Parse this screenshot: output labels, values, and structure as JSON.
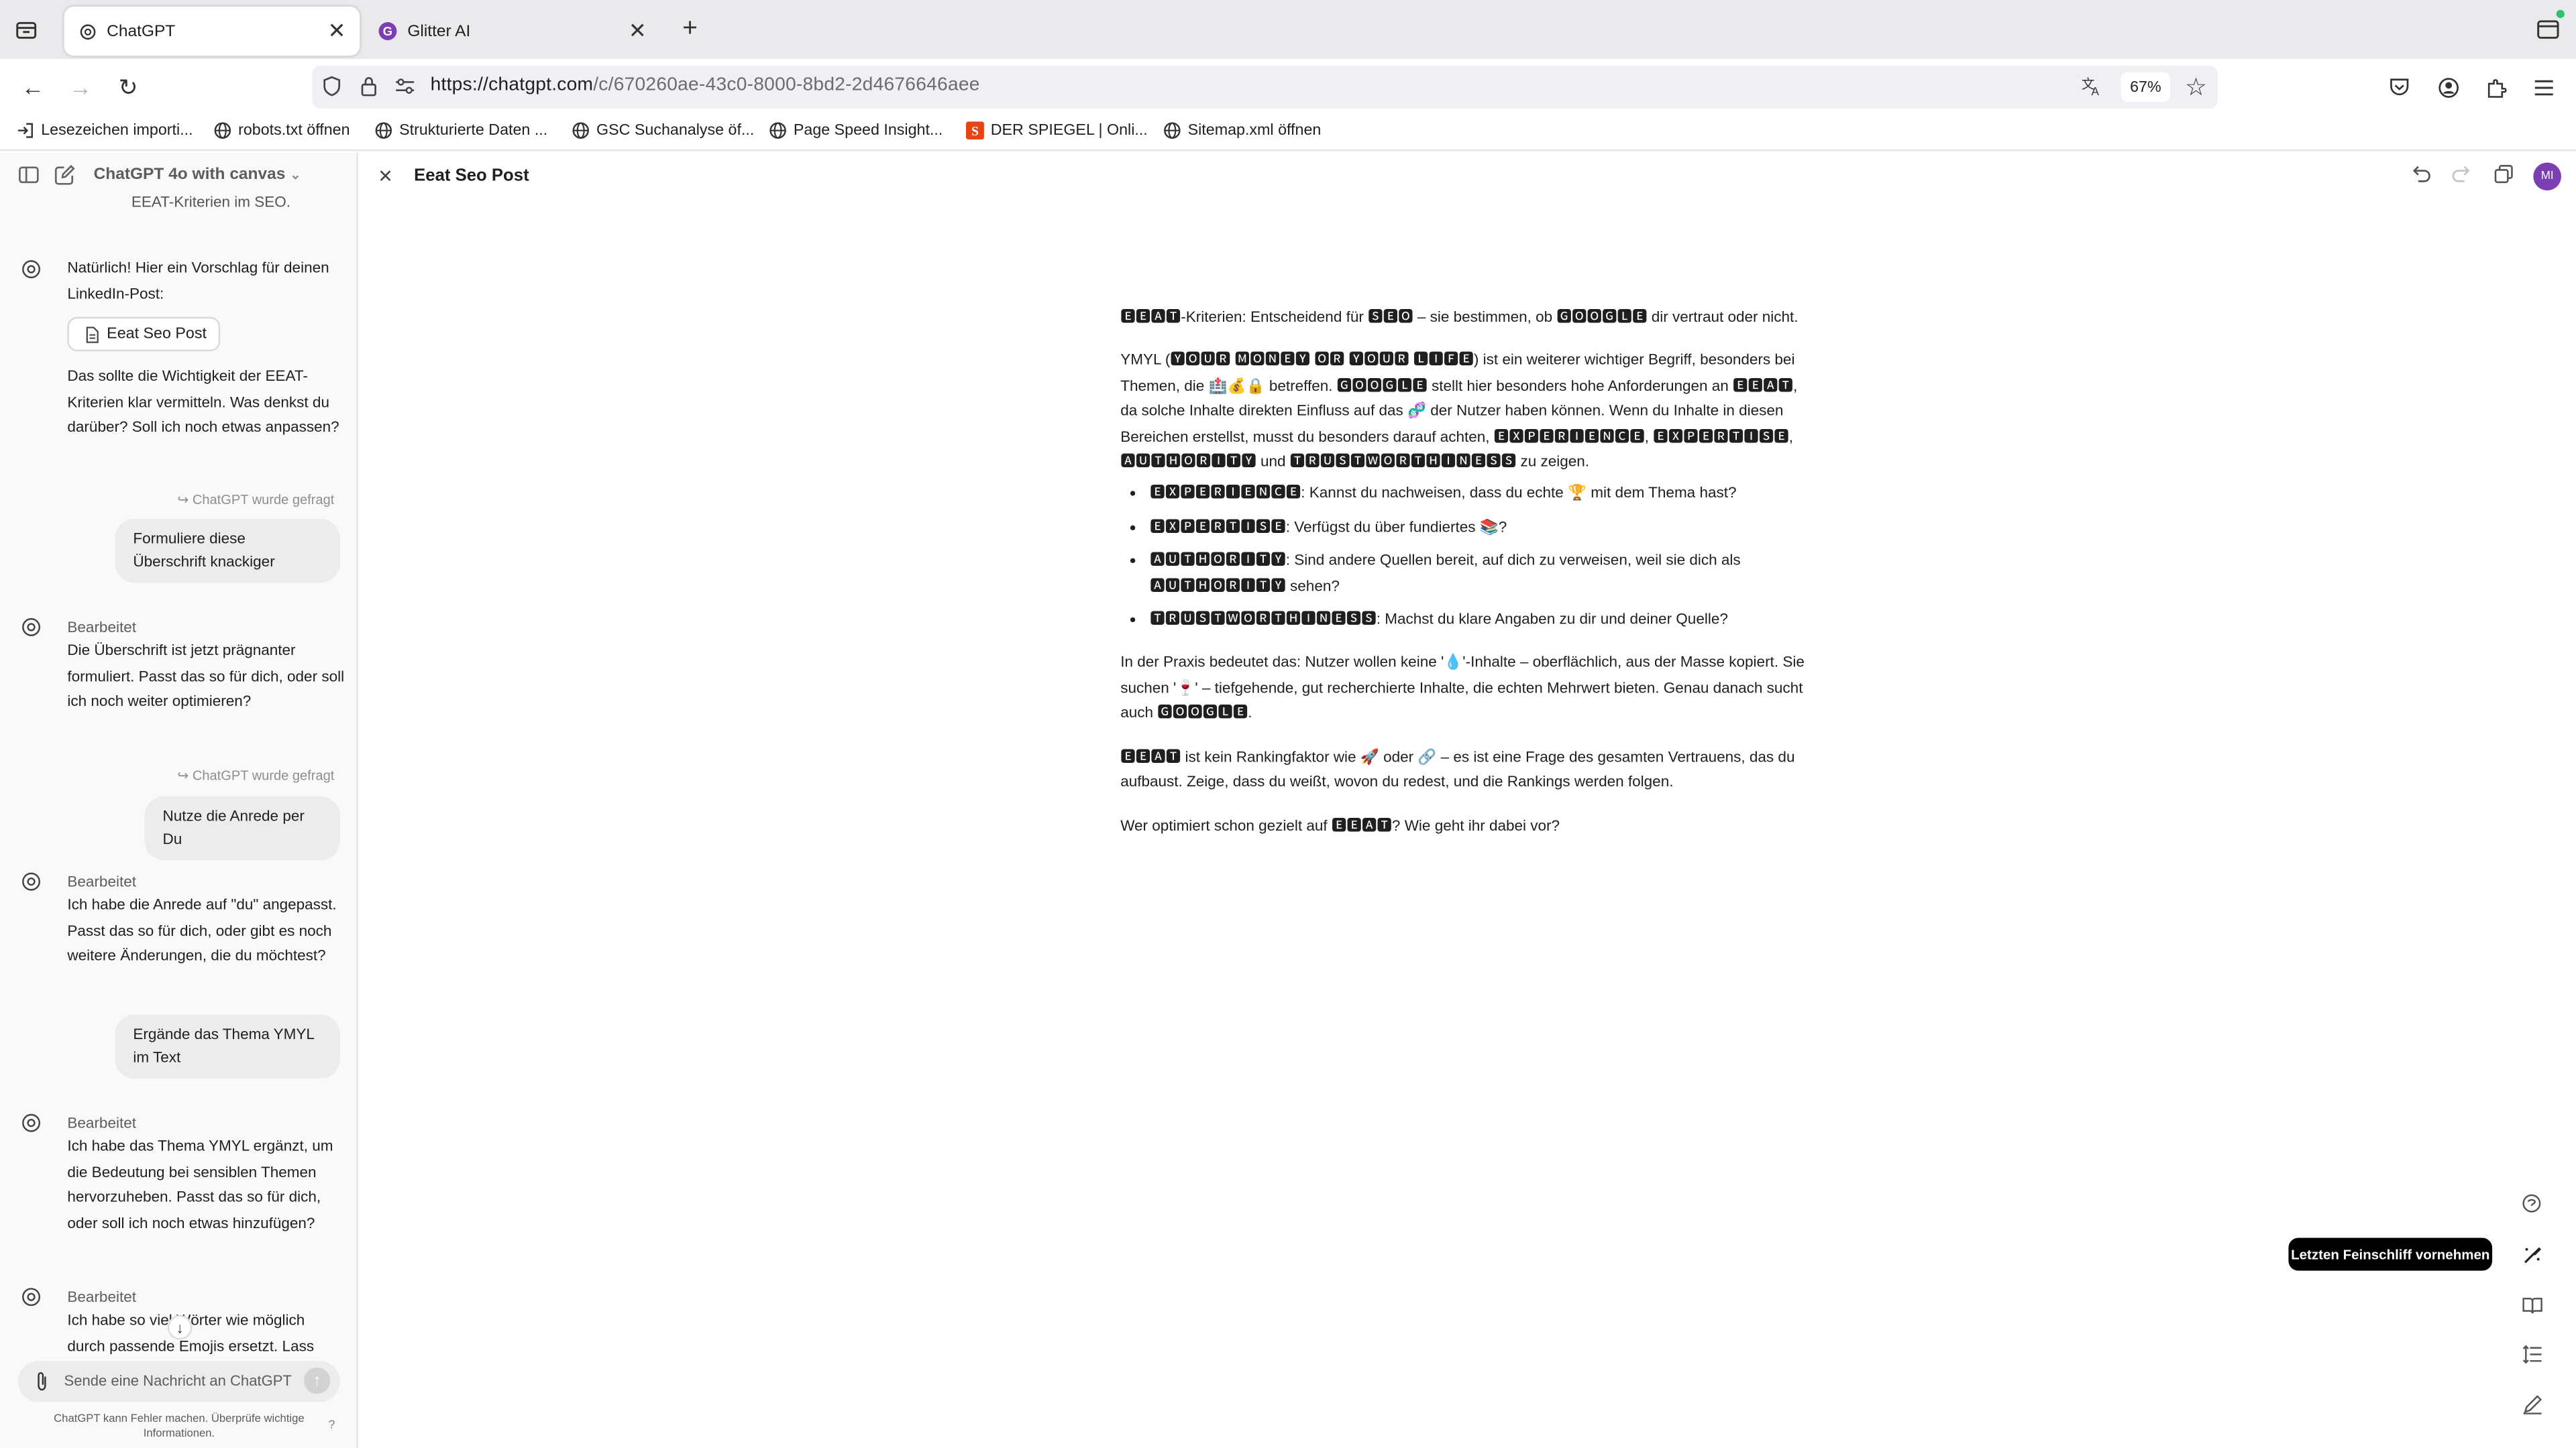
{
  "browser": {
    "tabs": [
      {
        "label": "ChatGPT",
        "icon": "chatgpt-icon",
        "active": true
      },
      {
        "label": "Glitter AI",
        "icon": "glitter-icon",
        "active": false
      }
    ],
    "url_domain": "https://chatgpt.com",
    "url_path": "/c/670260ae-43c0-8000-8bd2-2d4676646aee",
    "zoom": "67%",
    "bookmarks": [
      {
        "label": "Lesezeichen importi..."
      },
      {
        "label": "robots.txt öffnen"
      },
      {
        "label": "Strukturierte Daten ..."
      },
      {
        "label": "GSC Suchanalyse öf..."
      },
      {
        "label": "Page Speed Insight..."
      },
      {
        "label": "DER SPIEGEL | Onli..."
      },
      {
        "label": "Sitemap.xml öffnen"
      }
    ]
  },
  "sidebar": {
    "model": "ChatGPT 4o with canvas",
    "top_fragment": "EEAT-Kriterien im SEO.",
    "msg1": "Natürlich! Hier ein Vorschlag für deinen LinkedIn-Post:",
    "canvas_button": "Eeat Seo Post",
    "msg1b": "Das sollte die Wichtigkeit der EEAT-Kriterien klar vermitteln. Was denkst du darüber? Soll ich noch etwas anpassen?",
    "asked1": "ChatGPT wurde gefragt",
    "user1": "Formuliere diese Überschrift knackiger",
    "edited1": "Bearbeitet",
    "msg2": "Die Überschrift ist jetzt prägnanter formuliert. Passt das so für dich, oder soll ich noch weiter optimieren?",
    "asked2": "ChatGPT wurde gefragt",
    "user2": "Nutze die Anrede per Du",
    "edited2": "Bearbeitet",
    "msg3": "Ich habe die Anrede auf \"du\" angepasst. Passt das so für dich, oder gibt es noch weitere Änderungen, die du möchtest?",
    "user3": "Ergände das Thema YMYL im Text",
    "edited3": "Bearbeitet",
    "msg4": "Ich habe das Thema YMYL ergänzt, um die Bedeutung bei sensiblen Themen hervorzuheben. Passt das so für dich, oder soll ich noch etwas hinzufügen?",
    "edited4": "Bearbeitet",
    "msg5": "Ich habe so viel Wörter wie möglich durch passende Emojis ersetzt. Lass",
    "compose_placeholder": "Sende eine Nachricht an ChatGPT",
    "footnote": "ChatGPT kann Fehler machen. Überprüfe wichtige Informationen.",
    "help": "?"
  },
  "doc": {
    "title": "Eeat Seo Post",
    "p1": "🅴🅴🅰🆃-Kriterien: Entscheidend für 🆂🅴🅾 – sie bestimmen, ob 🅶🅾🅾🅶🅻🅴 dir vertraut oder nicht.",
    "p2": "YMYL (🆈🅾🆄🆁 🅼🅾🅽🅴🆈 🅾🆁 🆈🅾🆄🆁 🅻🅸🅵🅴) ist ein weiterer wichtiger Begriff, besonders bei Themen, die 🏥💰🔒 betreffen. 🅶🅾🅾🅶🅻🅴 stellt hier besonders hohe Anforderungen an 🅴🅴🅰🆃, da solche Inhalte direkten Einfluss auf das 🧬 der Nutzer haben können. Wenn du Inhalte in diesen Bereichen erstellst, musst du besonders darauf achten, 🅴🆇🅿🅴🆁🅸🅴🅽🅲🅴, 🅴🆇🅿🅴🆁🆃🅸🆂🅴, 🅰🆄🆃🅷🅾🆁🅸🆃🆈 und 🆃🆁🆄🆂🆃🆆🅾🆁🆃🅷🅸🅽🅴🆂🆂 zu zeigen.",
    "bullets": [
      "🅴🆇🅿🅴🆁🅸🅴🅽🅲🅴: Kannst du nachweisen, dass du echte 🏆 mit dem Thema hast?",
      "🅴🆇🅿🅴🆁🆃🅸🆂🅴: Verfügst du über fundiertes 📚?",
      "🅰🆄🆃🅷🅾🆁🅸🆃🆈: Sind andere Quellen bereit, auf dich zu verweisen, weil sie dich als 🅰🆄🆃🅷🅾🆁🅸🆃🆈 sehen?",
      "🆃🆁🆄🆂🆃🆆🅾🆁🆃🅷🅸🅽🅴🆂🆂: Machst du klare Angaben zu dir und deiner Quelle?"
    ],
    "p3": "In der Praxis bedeutet das: Nutzer wollen keine '💧'-Inhalte – oberflächlich, aus der Masse kopiert. Sie suchen '🍷' – tiefgehende, gut recherchierte Inhalte, die echten Mehrwert bieten. Genau danach sucht auch 🅶🅾🅾🅶🅻🅴.",
    "p4": "🅴🅴🅰🆃 ist kein Rankingfaktor wie 🚀 oder 🔗 – es ist eine Frage des gesamten Vertrauens, das du aufbaust. Zeige, dass du weißt, wovon du redest, und die Rankings werden folgen.",
    "p5": "Wer optimiert schon gezielt auf 🅴🅴🅰🆃? Wie geht ihr dabei vor?",
    "tooltip": "Letzten Feinschliff vornehmen",
    "avatar": "MI"
  },
  "colors": {
    "accent": "#7b3fb3",
    "tooltip_bg": "#000000",
    "bubble_bg": "#ececec"
  }
}
